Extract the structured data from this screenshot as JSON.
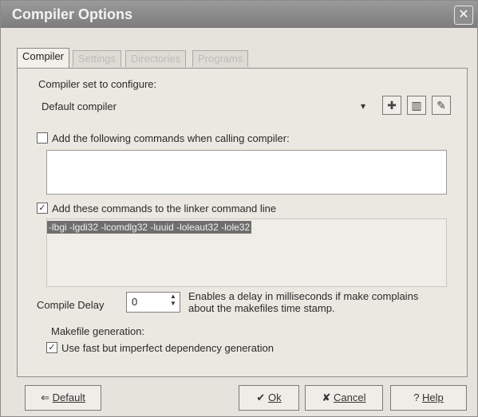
{
  "window": {
    "title": "Compiler Options",
    "close": "✕"
  },
  "tabs": [
    {
      "label": "Compiler",
      "active": true
    },
    {
      "label": "Settings",
      "active": false
    },
    {
      "label": "Directories",
      "active": false
    },
    {
      "label": "Programs",
      "active": false
    }
  ],
  "compiler_set": {
    "label": "Compiler set to configure:",
    "value": "Default compiler"
  },
  "compiler_set_icons": [
    "add-icon",
    "delete-icon",
    "rename-icon"
  ],
  "calling_commands": {
    "label": "Add the following commands when calling compiler:",
    "checked": false,
    "value": ""
  },
  "linker_commands": {
    "label": "Add these commands to the linker command line",
    "checked": true,
    "value": "-lbgi -lgdi32 -lcomdlg32 -luuid -loleaut32 -lole32"
  },
  "compile_delay": {
    "label": "Compile Delay",
    "value": "0",
    "description": "Enables a delay in milliseconds if make complains about the makefiles time stamp."
  },
  "makefile": {
    "label": "Makefile generation:",
    "option_label": "Use fast but imperfect dependency generation",
    "checked": true
  },
  "buttons": {
    "default": "Default",
    "ok": "Ok",
    "cancel": "Cancel",
    "help": "Help"
  }
}
